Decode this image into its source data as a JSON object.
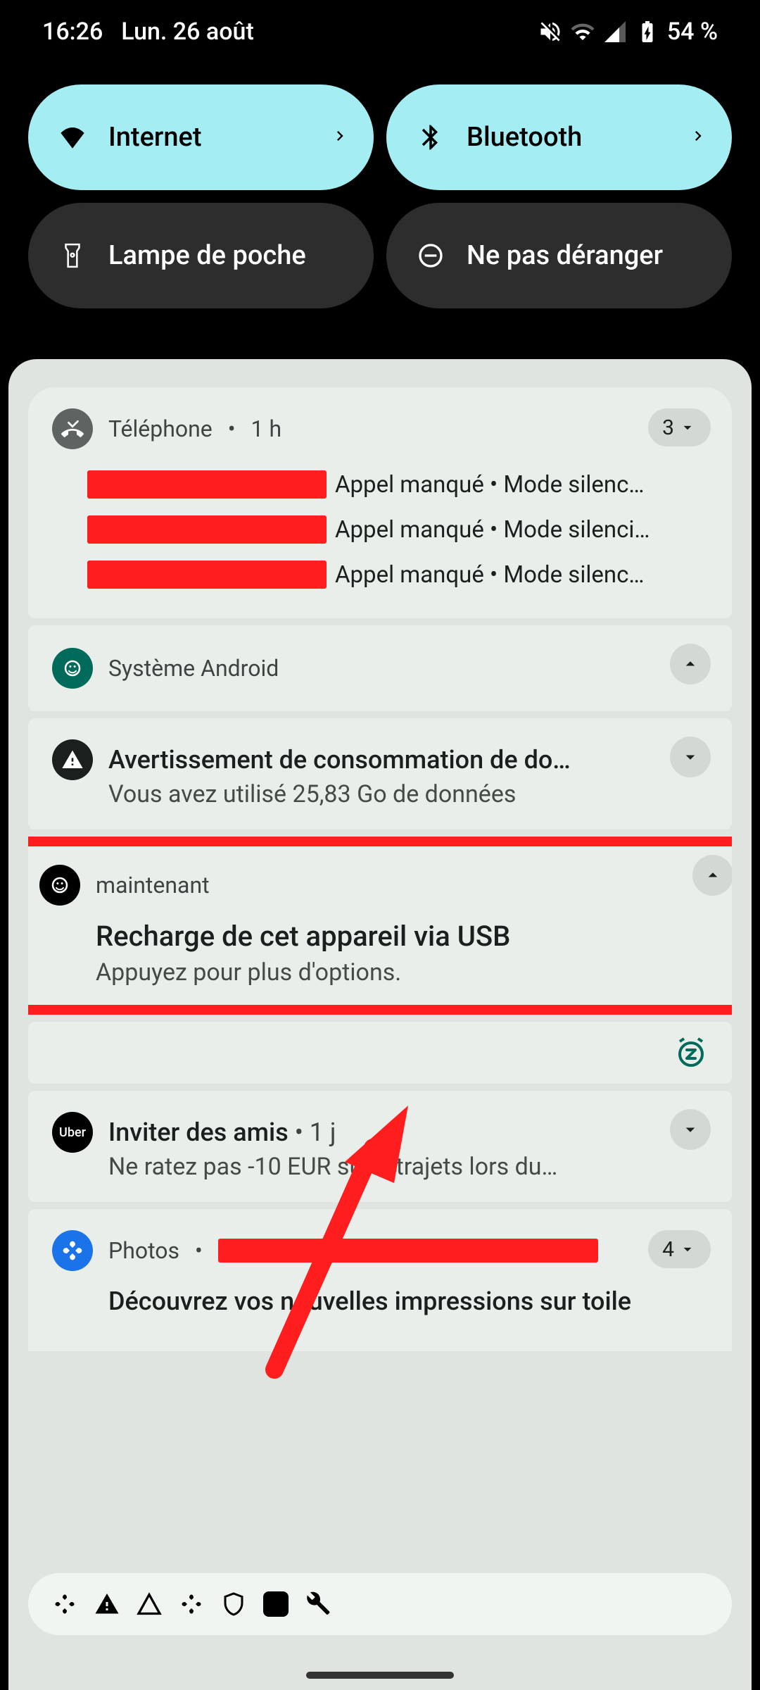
{
  "status": {
    "time": "16:26",
    "date": "Lun. 26 août",
    "battery": "54 %"
  },
  "qs": {
    "internet": "Internet",
    "bluetooth": "Bluetooth",
    "flashlight": "Lampe de poche",
    "dnd": "Ne pas déranger"
  },
  "notifications": {
    "phone": {
      "app": "Téléphone",
      "age": "1 h",
      "count": "3",
      "line_suffix": "Appel manqué • Mode silenc…",
      "line_suffix2": "Appel manqué • Mode silenci…"
    },
    "android_system": {
      "app": "Système Android"
    },
    "data_warning": {
      "title": "Avertissement de consommation de do…",
      "sub": "Vous avez utilisé 25,83 Go de données"
    },
    "usb": {
      "age": "maintenant",
      "title": "Recharge de cet appareil via USB",
      "sub": "Appuyez pour plus d'options."
    },
    "uber": {
      "title_prefix": "Inviter des amis",
      "title_age": "1 j",
      "sub": "Ne ratez pas -10 EUR sur 5 trajets lors du…"
    },
    "photos": {
      "app": "Photos",
      "count": "4",
      "title": "Découvrez vos nouvelles impressions sur toile"
    }
  }
}
